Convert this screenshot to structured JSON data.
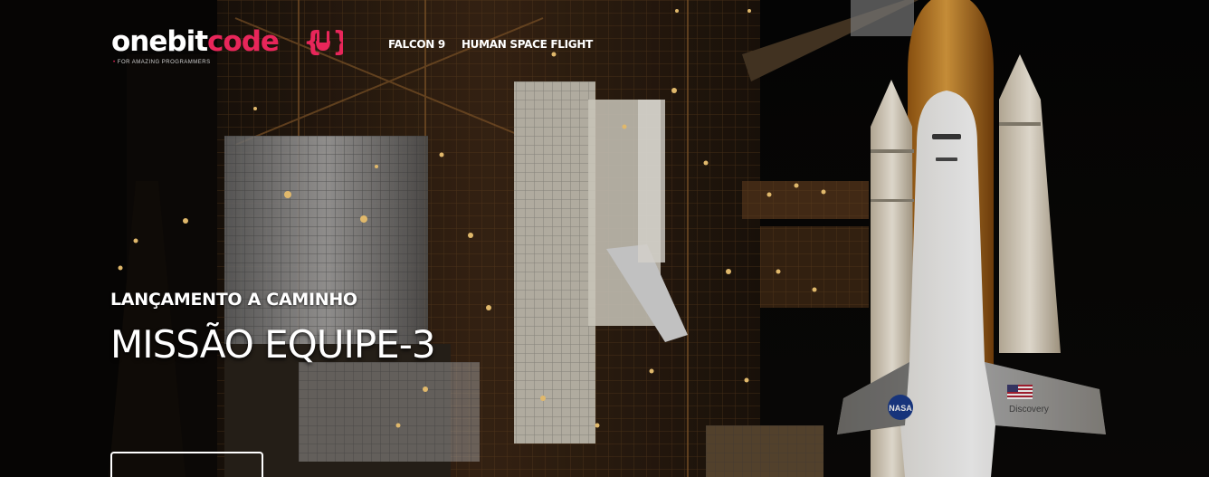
{
  "brand": {
    "name_part1": "onebit",
    "name_part2": "code",
    "tagline": "FOR AMAZING PROGRAMMERS",
    "accent_color": "#e8265a"
  },
  "nav": {
    "items": [
      {
        "label": "FALCON 9"
      },
      {
        "label": "HUMAN SPACE FLIGHT"
      }
    ]
  },
  "hero": {
    "subtitle": "LANÇAMENTO A CAMINHO",
    "title": "MISSÃO EQUIPE-3",
    "background_image": "night-launch-pad-space-shuttle",
    "shuttle_text": "Discovery",
    "shuttle_logo_text": "NASA"
  }
}
